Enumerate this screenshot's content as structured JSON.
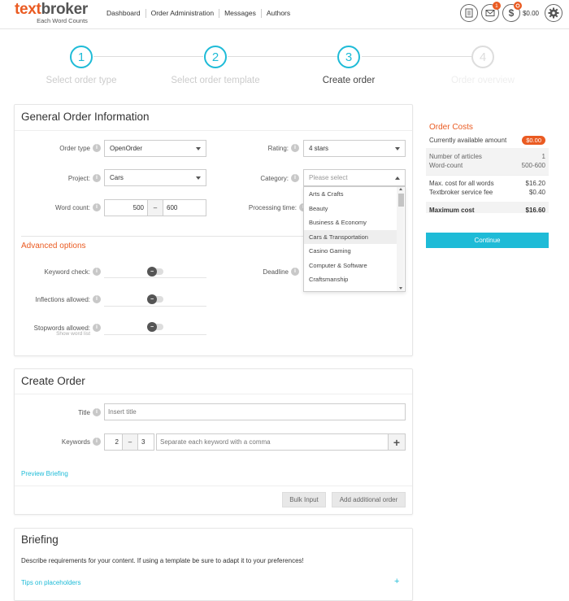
{
  "brand": {
    "name_part1": "text",
    "name_part2": "broker",
    "tagline": "Each Word Counts"
  },
  "nav": {
    "items": [
      "Dashboard",
      "Order Administration",
      "Messages",
      "Authors"
    ]
  },
  "header": {
    "messages_badge": "1",
    "balance": "$0.00"
  },
  "steps": [
    {
      "num": "1",
      "label": "Select order type",
      "state": "done"
    },
    {
      "num": "2",
      "label": "Select order template",
      "state": "done"
    },
    {
      "num": "3",
      "label": "Create order",
      "state": "active"
    },
    {
      "num": "4",
      "label": "Order overview",
      "state": "inactive"
    }
  ],
  "general": {
    "title": "General Order Information",
    "order_type_label": "Order type",
    "order_type_value": "OpenOrder",
    "rating_label": "Rating:",
    "rating_value": "4 stars",
    "project_label": "Project:",
    "project_value": "Cars",
    "category_label": "Category:",
    "category_placeholder": "Please select",
    "word_count_label": "Word count:",
    "word_min": "500",
    "word_sep": "–",
    "word_max": "600",
    "processing_label": "Processing time:",
    "advanced_title": "Advanced options",
    "keyword_check_label": "Keyword check:",
    "deadline_label": "Deadline",
    "inflections_label": "Inflections allowed:",
    "stopwords_label": "Stopwords allowed:",
    "show_word_list": "Show word list"
  },
  "category_options": [
    "Arts & Crafts",
    "Beauty",
    "Business & Economy",
    "Cars & Transportation",
    "Casino Gaming",
    "Computer & Software",
    "Craftsmanship"
  ],
  "create_order": {
    "title": "Create Order",
    "title_label": "Title",
    "title_placeholder": "Insert title",
    "keywords_label": "Keywords",
    "kw_min": "2",
    "kw_sep": "–",
    "kw_max": "3",
    "keywords_placeholder": "Separate each keyword with a comma",
    "preview_link": "Preview Briefing",
    "bulk_input": "Bulk Input",
    "add_order": "Add additional order"
  },
  "briefing": {
    "title": "Briefing",
    "description": "Describe requirements for your content. If using a template be sure to adapt it to your preferences!",
    "tips_link": "Tips on placeholders"
  },
  "costs": {
    "title": "Order Costs",
    "available_label": "Currently available amount",
    "available_value": "$0.00",
    "articles_label": "Number of articles",
    "articles_value": "1",
    "wordcount_label": "Word-count",
    "wordcount_value": "500-600",
    "maxcost_label": "Max. cost for all words",
    "maxcost_value": "$16.20",
    "fee_label": "Textbroker service fee",
    "fee_value": "$0.40",
    "maximum_label": "Maximum cost",
    "maximum_value": "$16.60",
    "continue": "Continue"
  },
  "colors": {
    "accent": "#1ebbd7",
    "brand_orange": "#ea5b22"
  }
}
